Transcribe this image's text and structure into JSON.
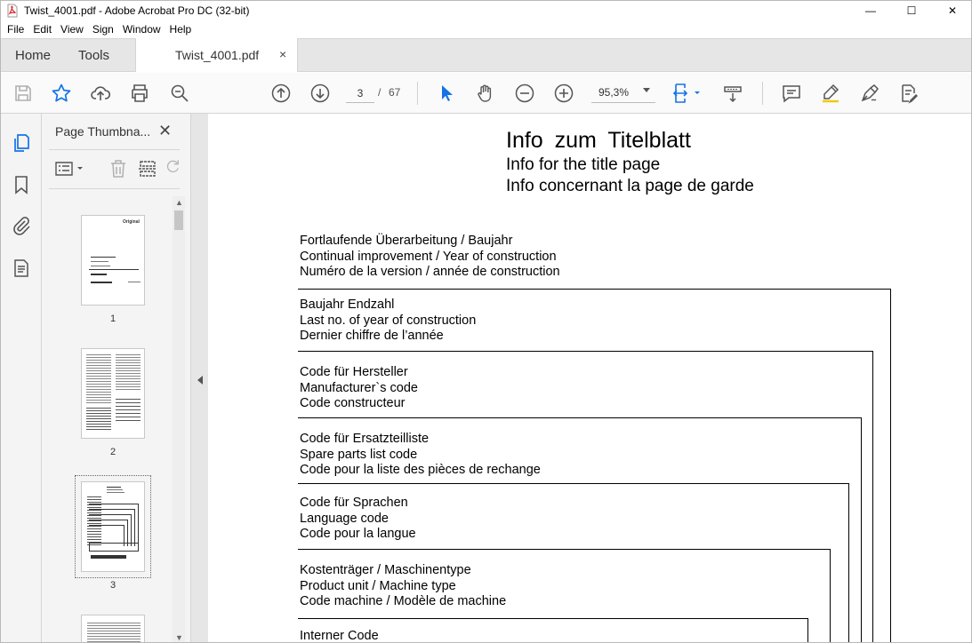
{
  "window": {
    "title": "Twist_4001.pdf - Adobe Acrobat Pro DC (32-bit)"
  },
  "menu": [
    "File",
    "Edit",
    "View",
    "Sign",
    "Window",
    "Help"
  ],
  "tabs": {
    "home": "Home",
    "tools": "Tools",
    "document": "Twist_4001.pdf",
    "close": "×"
  },
  "toolbar": {
    "current_page": "3",
    "page_separator": "/",
    "total_pages": "67",
    "zoom": "95,3%"
  },
  "panel": {
    "title": "Page Thumbna...",
    "close": "✕",
    "thumbnails": [
      {
        "label": "1"
      },
      {
        "label": "2"
      },
      {
        "label": "3"
      }
    ]
  },
  "document": {
    "title_de": "Info  zum  Titelblatt",
    "title_en": "Info for the title page",
    "title_fr": "Info concernant la page de garde",
    "sections": [
      {
        "lines": [
          "Fortlaufende Überarbeitung / Baujahr",
          "Continual improvement / Year of construction",
          "Numéro de la version / année de construction"
        ]
      },
      {
        "lines": [
          "Baujahr Endzahl",
          "Last no. of year of construction",
          "Dernier chiffre de l’année"
        ]
      },
      {
        "lines": [
          "Code für Hersteller",
          "Manufacturer`s  code",
          "Code constructeur"
        ]
      },
      {
        "lines": [
          "Code für Ersatzteilliste",
          "Spare parts list code",
          "Code pour la liste des pièces de rechange"
        ]
      },
      {
        "lines": [
          "Code für Sprachen",
          "Language code",
          "Code pour la langue"
        ]
      },
      {
        "lines": [
          "Kostenträger / Maschinentype",
          "Product unit / Machine type",
          "Code machine / Modèle de machine"
        ]
      },
      {
        "lines": [
          "Interner Code"
        ]
      }
    ]
  },
  "colors": {
    "accent_blue": "#1473e6",
    "toolbar_icon": "#555555"
  }
}
